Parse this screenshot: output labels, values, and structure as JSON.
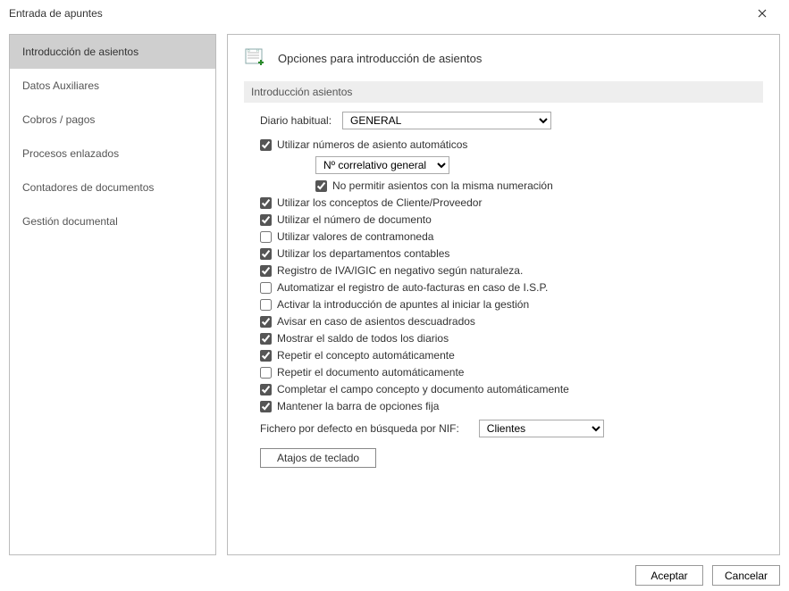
{
  "window": {
    "title": "Entrada de apuntes"
  },
  "sidebar": {
    "items": [
      {
        "label": "Introducción de asientos",
        "selected": true
      },
      {
        "label": "Datos Auxiliares",
        "selected": false
      },
      {
        "label": "Cobros / pagos",
        "selected": false
      },
      {
        "label": "Procesos enlazados",
        "selected": false
      },
      {
        "label": "Contadores de documentos",
        "selected": false
      },
      {
        "label": "Gestión documental",
        "selected": false
      }
    ]
  },
  "main": {
    "header_title": "Opciones para introducción de asientos",
    "section_title": "Introducción asientos",
    "diario_label": "Diario habitual:",
    "diario_value": "GENERAL",
    "correlativo_value": "Nº correlativo general",
    "checkboxes": {
      "auto_num": {
        "label": "Utilizar números de asiento automáticos",
        "checked": true
      },
      "no_dup": {
        "label": "No permitir asientos con la misma numeración",
        "checked": true
      },
      "conceptos_cp": {
        "label": "Utilizar los conceptos de Cliente/Proveedor",
        "checked": true
      },
      "num_doc": {
        "label": "Utilizar el número de documento",
        "checked": true
      },
      "contramoneda": {
        "label": "Utilizar valores de contramoneda",
        "checked": false
      },
      "departamentos": {
        "label": "Utilizar los departamentos contables",
        "checked": true
      },
      "iva_neg": {
        "label": "Registro de IVA/IGIC en negativo según naturaleza.",
        "checked": true
      },
      "autofact": {
        "label": "Automatizar el registro de auto-facturas en caso de I.S.P.",
        "checked": false
      },
      "activar_inicio": {
        "label": "Activar la introducción de apuntes al iniciar la gestión",
        "checked": false
      },
      "avisar_desc": {
        "label": "Avisar en caso de asientos descuadrados",
        "checked": true
      },
      "mostrar_saldo": {
        "label": "Mostrar el saldo de todos los diarios",
        "checked": true
      },
      "repetir_concepto": {
        "label": "Repetir el concepto automáticamente",
        "checked": true
      },
      "repetir_doc": {
        "label": "Repetir el documento automáticamente",
        "checked": false
      },
      "completar_cd": {
        "label": "Completar el campo concepto y documento automáticamente",
        "checked": true
      },
      "barra_fija": {
        "label": "Mantener la barra de opciones fija",
        "checked": true
      }
    },
    "fichero_label": "Fichero por defecto en búsqueda por NIF:",
    "fichero_value": "Clientes",
    "atajos_label": "Atajos de teclado"
  },
  "footer": {
    "accept": "Aceptar",
    "cancel": "Cancelar"
  }
}
